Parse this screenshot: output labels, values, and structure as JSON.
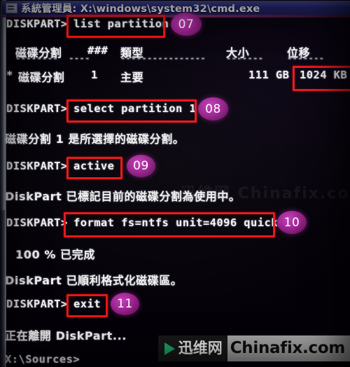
{
  "window": {
    "title": "系統管理員: X:\\windows\\system32\\cmd.exe",
    "icon": "cmd-window-icon"
  },
  "console": {
    "prompt": "DISKPART>",
    "lines": [
      {
        "id": "l1",
        "prompt": "DISKPART>",
        "text": "list partition"
      },
      {
        "id": "l2",
        "text": "磁碟分割   ###  類型                大小     位移"
      },
      {
        "id": "l3",
        "text": "*  磁碟分割    1    主要                111 GB   1024 KB"
      },
      {
        "id": "l4",
        "prompt": "DISKPART>",
        "text": "select partition 1"
      },
      {
        "id": "l5",
        "text": "磁碟分割 1 是所選擇的磁碟分割。"
      },
      {
        "id": "l6",
        "prompt": "DISKPART>",
        "text": "active"
      },
      {
        "id": "l7",
        "text": "DiskPart 已標記目前的磁碟分割為使用中。"
      },
      {
        "id": "l8",
        "prompt": "DISKPART>",
        "text": "format fs=ntfs unit=4096 quick"
      },
      {
        "id": "l9",
        "text": "100 % 已完成"
      },
      {
        "id": "l10",
        "text": "DiskPart 已順利格式化磁碟區。"
      },
      {
        "id": "l11",
        "prompt": "DISKPART>",
        "text": "exit"
      },
      {
        "id": "l12",
        "text": "正在離開 DiskPart..."
      },
      {
        "id": "l13",
        "text": "X:\\Sources>"
      }
    ],
    "table": {
      "headers": [
        "磁碟分割",
        "###",
        "類型",
        "大小",
        "位移"
      ],
      "rows": [
        {
          "marker": "*",
          "name": "磁碟分割",
          "num": "1",
          "type": "主要",
          "size": "111 GB",
          "offset": "1024 KB"
        }
      ]
    }
  },
  "annotations": {
    "accent_red": "#e81515",
    "badge_color": "#9d228f",
    "badges": [
      {
        "label": "07",
        "target": "list partition"
      },
      {
        "label": "08",
        "target": "select partition 1"
      },
      {
        "label": "09",
        "target": "active"
      },
      {
        "label": "10",
        "target": "format fs=ntfs unit=4096 quick"
      },
      {
        "label": "11",
        "target": "exit"
      }
    ],
    "boxes": [
      {
        "target": "list partition"
      },
      {
        "target": "1024 KB"
      },
      {
        "target": "select partition 1"
      },
      {
        "target": "active"
      },
      {
        "target": "format fs=ntfs unit=4096 quick"
      },
      {
        "target": "exit"
      }
    ]
  },
  "watermark": {
    "cn": "迅维网",
    "en": "Chinafix.com",
    "ghost": "迅维网 Chinafix.com"
  }
}
